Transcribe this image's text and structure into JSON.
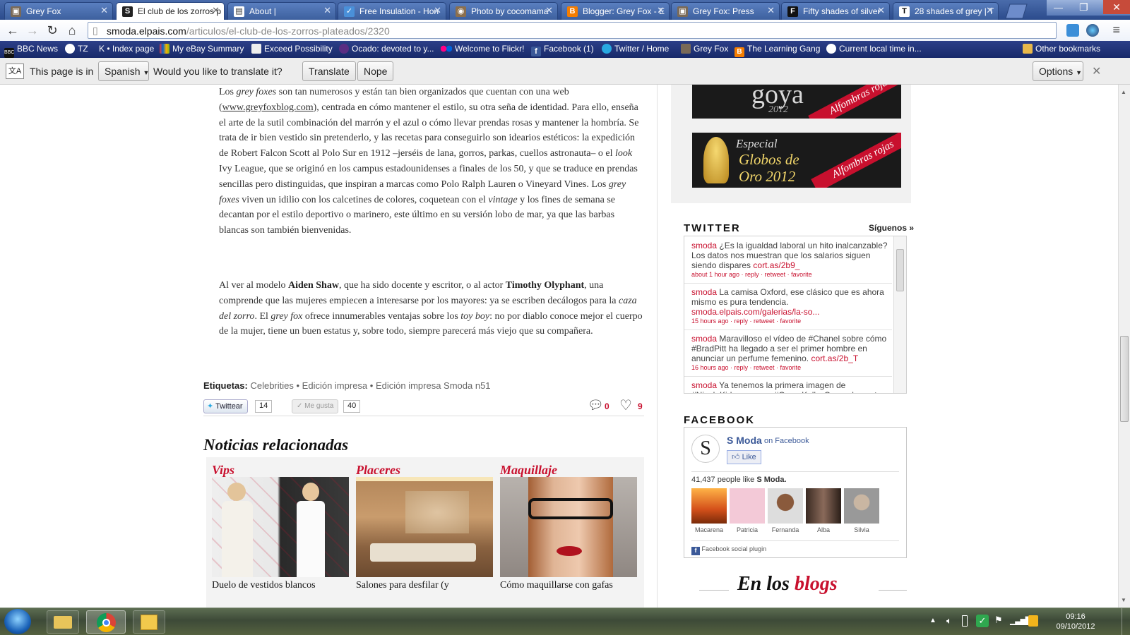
{
  "tabs": [
    {
      "title": "Grey Fox",
      "favicon": "grey-fox-favicon",
      "active": false
    },
    {
      "title": "El club de los zorros p",
      "favicon": "smoda-favicon",
      "active": true
    },
    {
      "title": "About |",
      "favicon": "page-favicon",
      "active": false
    },
    {
      "title": "Free Insulation - Hon",
      "favicon": "insulation-favicon",
      "active": false
    },
    {
      "title": "Photo by cocomama",
      "favicon": "photo-favicon",
      "active": false
    },
    {
      "title": "Blogger: Grey Fox - E",
      "favicon": "blogger-favicon",
      "active": false
    },
    {
      "title": "Grey Fox: Press",
      "favicon": "grey-fox-favicon",
      "active": false
    },
    {
      "title": "Fifty shades of silver",
      "favicon": "f-favicon",
      "active": false
    },
    {
      "title": "28 shades of grey | T",
      "favicon": "t-favicon",
      "active": false
    }
  ],
  "toolbar": {
    "url_host": "smoda.elpais.com",
    "url_path": "/articulos/el-club-de-los-zorros-plateados/2320"
  },
  "bookmarks": [
    {
      "label": "BBC News",
      "icon": "bbc-icon"
    },
    {
      "label": "TZ",
      "icon": "tz-icon"
    },
    {
      "label": "K • Index page",
      "icon": "index-icon"
    },
    {
      "label": "My eBay Summary",
      "icon": "ebay-icon"
    },
    {
      "label": "Exceed Possibility",
      "icon": "page-icon"
    },
    {
      "label": "Ocado: devoted to y...",
      "icon": "ocado-icon"
    },
    {
      "label": "Welcome to Flickr!",
      "icon": "flickr-icon"
    },
    {
      "label": "Facebook (1)",
      "icon": "facebook-icon"
    },
    {
      "label": "Twitter / Home",
      "icon": "twitter-icon"
    },
    {
      "label": "Grey Fox",
      "icon": "grey-fox-icon"
    },
    {
      "label": "The Learning Gang",
      "icon": "blogger-icon"
    },
    {
      "label": "Current local time in...",
      "icon": "clock-icon"
    }
  ],
  "other_bookmarks": "Other bookmarks",
  "infobar": {
    "prefix": "This page is in",
    "language": "Spanish",
    "question": "Would you like to translate it?",
    "translate": "Translate",
    "nope": "Nope",
    "options": "Options"
  },
  "article": {
    "p1": [
      {
        "t": "Los "
      },
      {
        "t": "grey foxes",
        "i": true
      },
      {
        "t": " son tan numerosos y están tan bien organizados que cuentan con una web ("
      },
      {
        "t": "www.greyfoxblog.com",
        "u": true
      },
      {
        "t": "), centrada en cómo mantener el estilo, su otra seña de identidad. Para ello, enseña el arte de la sutil combinación del marrón y el azul o cómo llevar prendas rosas y mantener la hombría. Se trata de ir bien vestido sin pretenderlo, y las recetas para conseguirlo son idearios estéticos: la expedición de Robert Falcon Scott al Polo Sur en 1912 –jerséis de lana, gorros, parkas, cuellos astronauta– o el "
      },
      {
        "t": "look",
        "i": true
      },
      {
        "t": " Ivy League, que se originó en los campus estadounidenses a finales de los 50, y que se traduce en prendas sencillas pero distinguidas, que inspiran a marcas como Polo Ralph Lauren o Vineyard Vines. Los "
      },
      {
        "t": "grey foxes",
        "i": true
      },
      {
        "t": " viven un idilio con los calcetines de colores, coquetean con el "
      },
      {
        "t": "vintage",
        "i": true
      },
      {
        "t": " y los fines de semana se decantan por el estilo deportivo o marinero, este último en su versión lobo de mar, ya que las barbas blancas son también bienvenidas."
      }
    ],
    "p2": [
      {
        "t": "Al ver al modelo "
      },
      {
        "t": "Aiden Shaw",
        "b": true
      },
      {
        "t": ", que ha sido docente y escritor, o al actor "
      },
      {
        "t": "Timothy Olyphant",
        "b": true
      },
      {
        "t": ", una comprende que las mujeres empiecen a interesarse por los mayores: ya se escriben decálogos para la "
      },
      {
        "t": "caza del zorro",
        "i": true
      },
      {
        "t": ". El "
      },
      {
        "t": "grey fox",
        "i": true
      },
      {
        "t": " ofrece innumerables ventajas sobre los "
      },
      {
        "t": "toy boy",
        "i": true
      },
      {
        "t": ": no por diablo conoce mejor el cuerpo de la mujer, tiene un buen estatus y, sobre todo, siempre parecerá más viejo que su compañera."
      }
    ],
    "tags_label": "Etiquetas:",
    "tags": [
      "Celebrities",
      "Edición impresa",
      "Edición impresa Smoda n51"
    ],
    "tweet_btn": "Twittear",
    "tweet_count": "14",
    "like_btn": "Me gusta",
    "like_count": "40",
    "comments": "0",
    "hearts": "9"
  },
  "related": {
    "heading": "Noticias relacionadas",
    "items": [
      {
        "category": "Vips",
        "title": "Duelo de vestidos blancos"
      },
      {
        "category": "Placeres",
        "title": "Salones para desfilar (y"
      },
      {
        "category": "Maquillaje",
        "title": "Cómo maquillarse con gafas"
      }
    ]
  },
  "sidebar": {
    "goya_word": "goya",
    "goya_year": "2012",
    "alfombras": "Alfombras rojas",
    "globos_especial": "Especial",
    "globos_title": "Globos de",
    "globos_year": "Oro 2012",
    "twitter_heading": "TWITTER",
    "siguenos": "Síguenos »",
    "tweets": [
      {
        "user": "smoda",
        "text": "¿Es la igualdad laboral un hito inalcanzable? Los datos nos muestran que los salarios siguen siendo dispares",
        "link": "cort.as/2b9_",
        "meta": "about 1 hour ago · reply · retweet · favorite"
      },
      {
        "user": "smoda",
        "text": "La camisa Oxford, ese clásico que es ahora mismo es pura tendencia.",
        "link": "smoda.elpais.com/galerias/la-so...",
        "meta": "15 hours ago · reply · retweet · favorite"
      },
      {
        "user": "smoda",
        "text": "Maravilloso el vídeo de #Chanel sobre cómo #BradPitt ha llegado a ser el primer hombre en anunciar un perfume femenino.",
        "link": "cort.as/2b_T",
        "meta": "16 hours ago · reply · retweet · favorite"
      },
      {
        "user": "smoda",
        "text": "Ya tenemos la primera imagen de #NicoleKidman como #GraceKelly. Como dos gotas",
        "link": "",
        "meta": ""
      }
    ],
    "facebook_heading": "FACEBOOK",
    "fb_page": "S Moda",
    "fb_on": "on Facebook",
    "fb_like": "Like",
    "fb_count_text": "41,437 people like",
    "fb_count_page": "S Moda.",
    "fb_faces": [
      "Macarena",
      "Patricia",
      "Fernanda",
      "Alba",
      "Silvia"
    ],
    "fb_plugin": "Facebook social plugin",
    "blogs_1": "En los",
    "blogs_2": "blogs"
  },
  "taskbar": {
    "time": "09:16",
    "date": "09/10/2012"
  },
  "colors": {
    "accent_red": "#c8102e",
    "chrome_blue": "#2b4b8c",
    "link_blue": "#3b5998"
  }
}
